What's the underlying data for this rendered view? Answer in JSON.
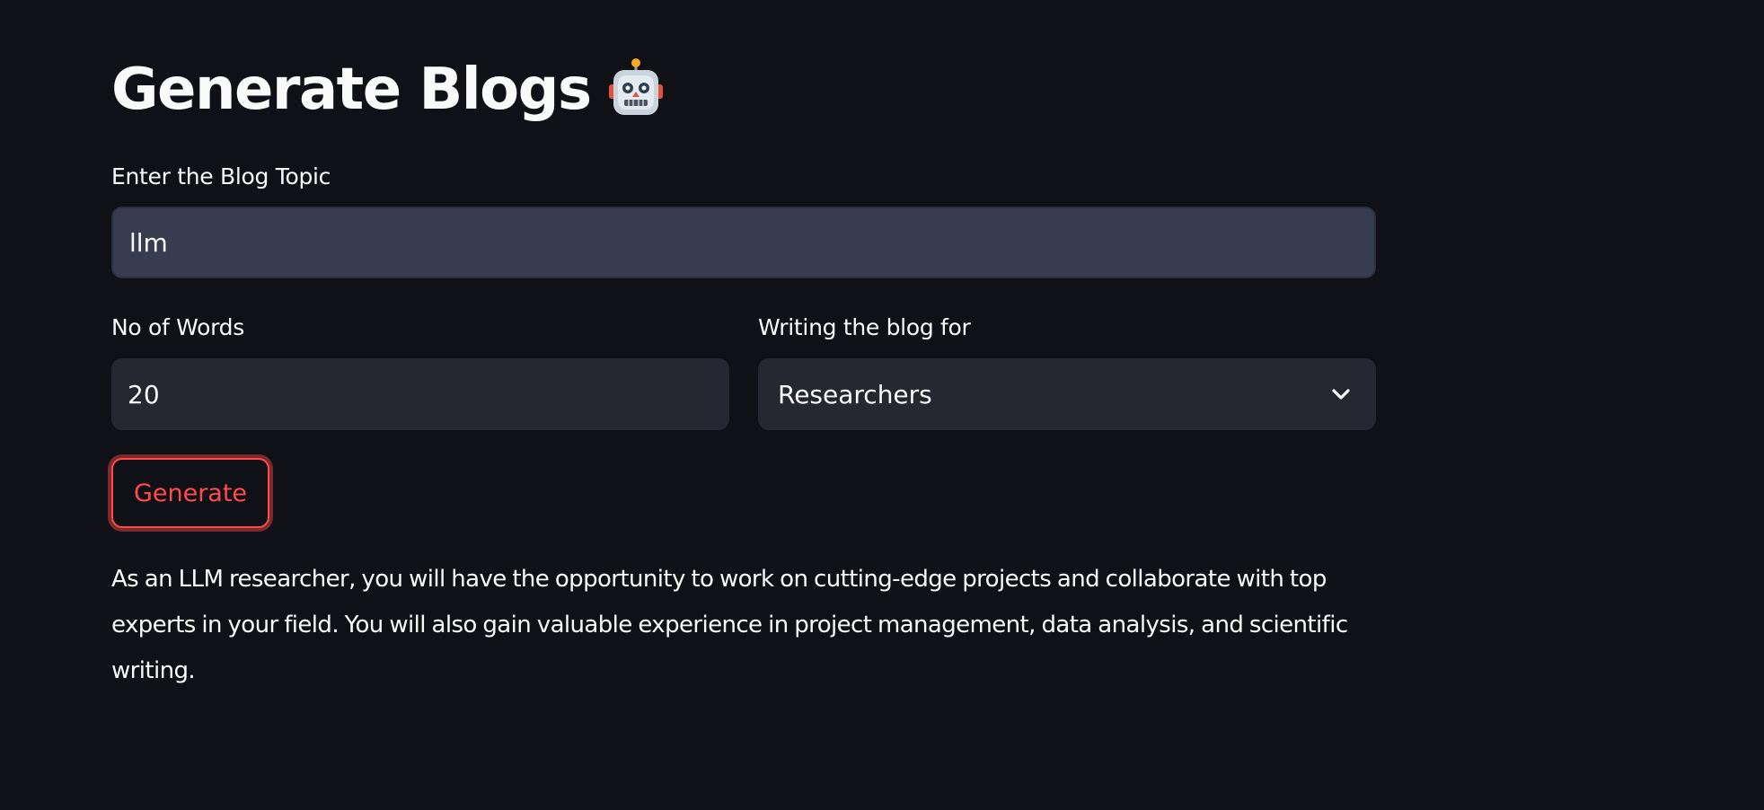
{
  "page": {
    "title": "Generate Blogs",
    "title_icon": "robot-face-icon"
  },
  "form": {
    "topic": {
      "label": "Enter the Blog Topic",
      "value": "llm"
    },
    "words": {
      "label": "No of Words",
      "value": "20"
    },
    "audience": {
      "label": "Writing the blog for",
      "selected": "Researchers",
      "icon": "chevron-down-icon"
    },
    "generate_label": "Generate"
  },
  "output": {
    "text": "As an LLM researcher, you will have the opportunity to work on cutting-edge projects and collaborate with top experts in your field. You will also gain valuable experience in project management, data analysis, and scientific writing."
  },
  "colors": {
    "background": "#0f1117",
    "input_active": "#373c4f",
    "input": "#262730",
    "accent": "#ff4b4b",
    "text": "#fafafa"
  }
}
